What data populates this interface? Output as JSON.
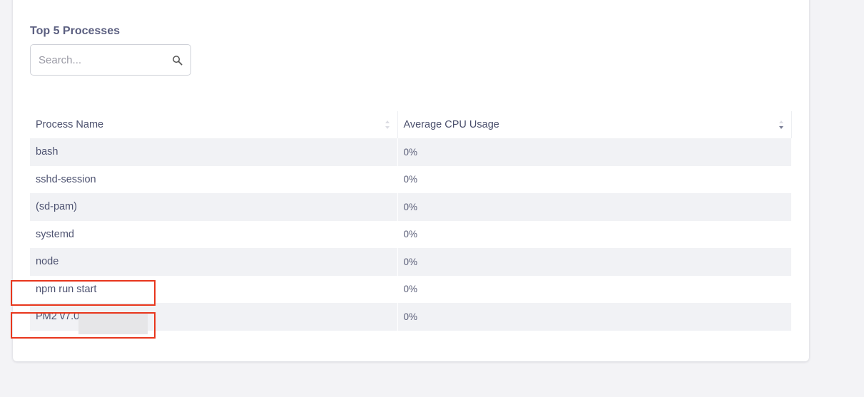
{
  "panel": {
    "title": "Top 5 Processes"
  },
  "search": {
    "placeholder": "Search...",
    "icon": "search-icon"
  },
  "table": {
    "headers": {
      "process_name": "Process Name",
      "avg_cpu": "Average CPU Usage"
    },
    "rows": [
      {
        "name": "bash",
        "cpu": "0%"
      },
      {
        "name": "sshd-session",
        "cpu": "0%"
      },
      {
        "name": "(sd-pam)",
        "cpu": "0%"
      },
      {
        "name": "systemd",
        "cpu": "0%"
      },
      {
        "name": "node",
        "cpu": "0%"
      },
      {
        "name": "npm run start",
        "cpu": "0%"
      },
      {
        "name": "PM2 v7.0.3",
        "cpu": "0%"
      }
    ]
  },
  "colors": {
    "highlight": "#e8361c",
    "row_stripe": "#f1f2f5",
    "text": "#4d5270"
  }
}
